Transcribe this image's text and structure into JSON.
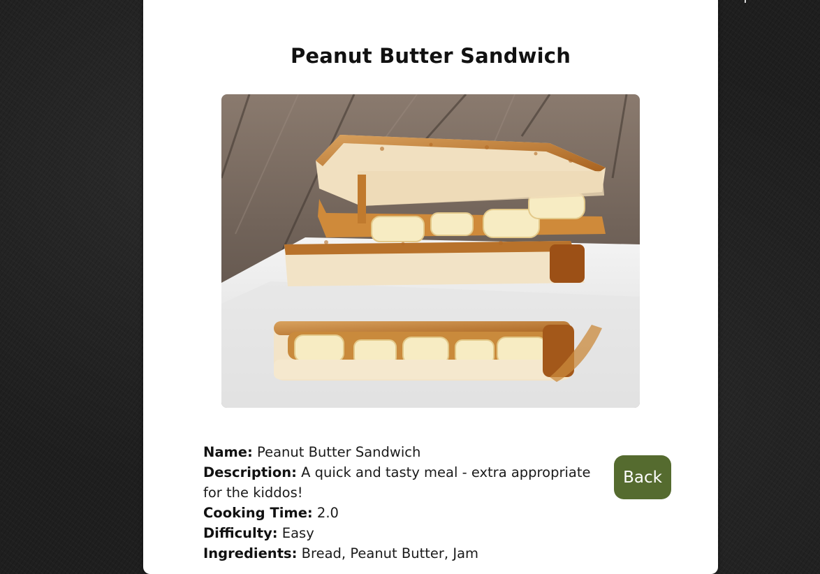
{
  "recipe": {
    "title": "Peanut Butter Sandwich",
    "image_alt": "Peanut Butter Sandwich",
    "details": {
      "name_label": "Name:",
      "name_value": "Peanut Butter Sandwich",
      "description_label": "Description:",
      "description_value": "A quick and tasty meal - extra appropriate for the kiddos!",
      "cooking_time_label": "Cooking Time:",
      "cooking_time_value": "2.0",
      "difficulty_label": "Difficulty:",
      "difficulty_value": "Easy",
      "ingredients_label": "Ingredients:",
      "ingredients_value": "Bread, Peanut Butter, Jam"
    }
  },
  "actions": {
    "back_label": "Back"
  },
  "colors": {
    "page_background": "#1f1f1f",
    "card_background": "#ffffff",
    "back_button": "#556b2f",
    "back_button_text": "#ffffff",
    "text": "#111111"
  }
}
